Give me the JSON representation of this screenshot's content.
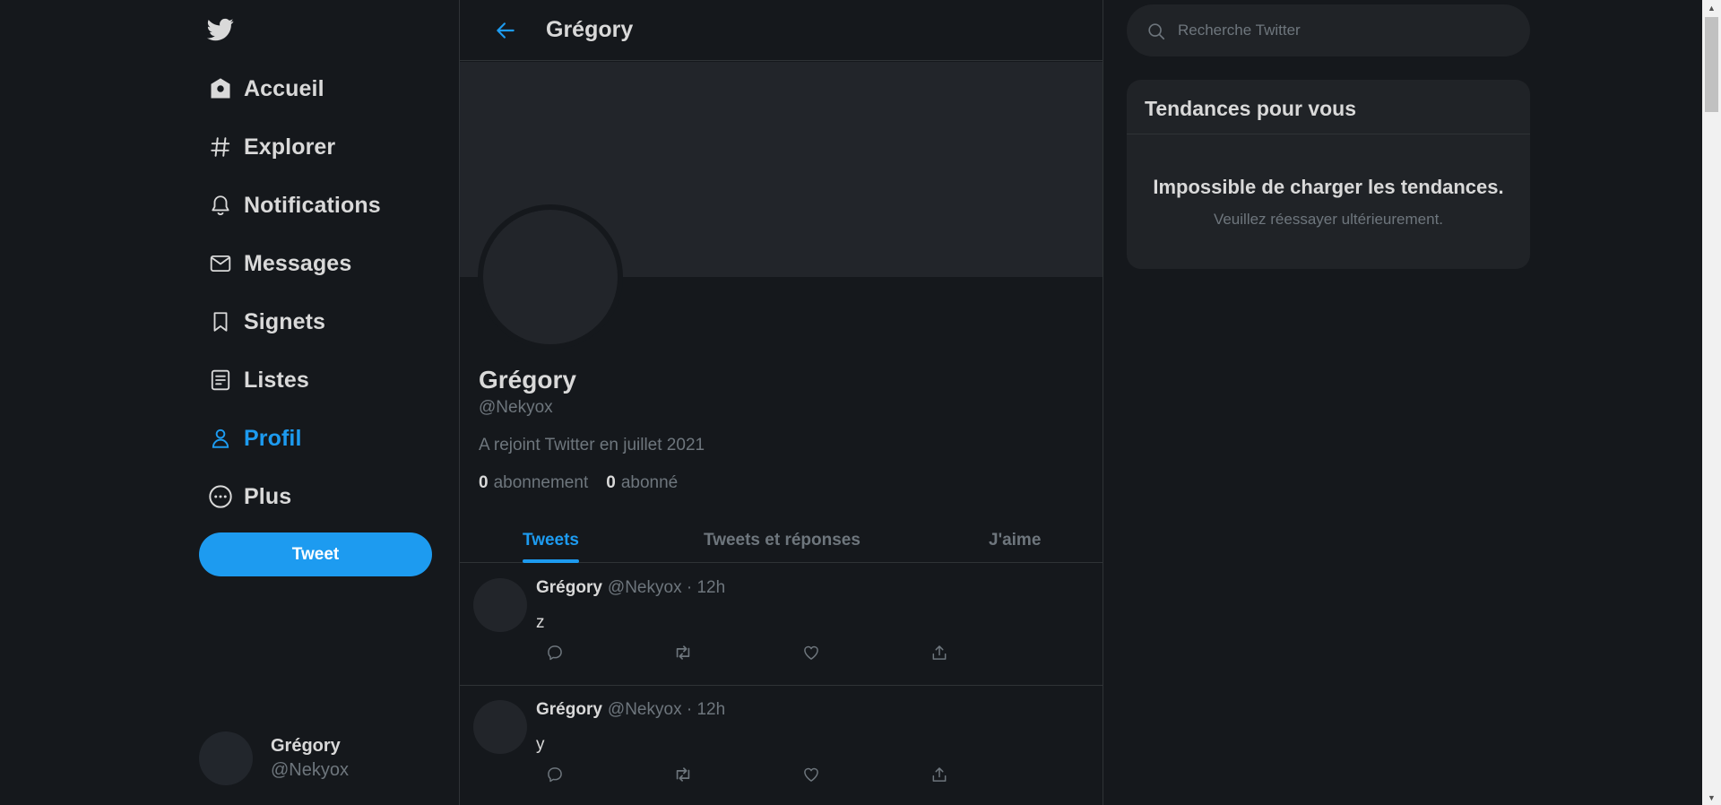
{
  "sidebar": {
    "logo_icon": "twitter-bird-icon",
    "items": [
      {
        "label": "Accueil",
        "icon": "home-icon"
      },
      {
        "label": "Explorer",
        "icon": "hashtag-icon"
      },
      {
        "label": "Notifications",
        "icon": "bell-icon"
      },
      {
        "label": "Messages",
        "icon": "mail-icon"
      },
      {
        "label": "Signets",
        "icon": "bookmark-icon"
      },
      {
        "label": "Listes",
        "icon": "list-icon"
      },
      {
        "label": "Profil",
        "icon": "user-icon",
        "active": true
      },
      {
        "label": "Plus",
        "icon": "more-icon"
      }
    ],
    "tweet_button": "Tweet",
    "account": {
      "name": "Grégory",
      "handle": "@Nekyox"
    }
  },
  "header": {
    "title": "Grégory"
  },
  "profile": {
    "name": "Grégory",
    "handle": "@Nekyox",
    "joined": "A rejoint Twitter en juillet 2021",
    "following_count": "0",
    "following_label": "abonnement",
    "followers_count": "0",
    "followers_label": "abonné"
  },
  "tabs": [
    {
      "label": "Tweets",
      "active": true
    },
    {
      "label": "Tweets et réponses"
    },
    {
      "label": "J'aime"
    }
  ],
  "tweets": [
    {
      "name": "Grégory",
      "meta": "@Nekyox · 12h",
      "text": "z"
    },
    {
      "name": "Grégory",
      "meta": "@Nekyox · 12h",
      "text": "y"
    }
  ],
  "search": {
    "placeholder": "Recherche Twitter"
  },
  "trends": {
    "title": "Tendances pour vous",
    "error": "Impossible de charger les tendances.",
    "retry": "Veuillez réessayer ultérieurement."
  },
  "colors": {
    "background": "#15181c",
    "accent": "#1d9bf0",
    "card": "#202327",
    "muted_text": "#6e767d",
    "border": "#2f3336"
  }
}
